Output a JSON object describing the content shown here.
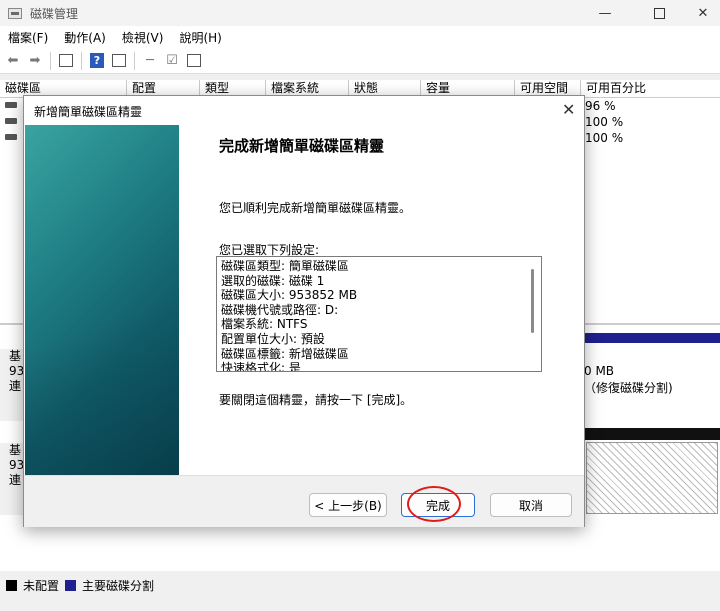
{
  "window": {
    "title": "磁碟管理",
    "minimize": "—",
    "close": "✕"
  },
  "menu": [
    "檔案(F)",
    "動作(A)",
    "檢視(V)",
    "說明(H)"
  ],
  "volume_table": {
    "headers": [
      "磁碟區",
      "配置",
      "類型",
      "檔案系統",
      "狀態",
      "容量",
      "可用空間",
      "可用百分比"
    ],
    "rows": [
      {
        "percent_free": "96 %"
      },
      {
        "percent_free": "100 %"
      },
      {
        "percent_free": "100 %"
      }
    ]
  },
  "disks": [
    {
      "lines": [
        "基",
        "93",
        "連"
      ]
    },
    {
      "lines": [
        "基",
        "93",
        "連"
      ]
    }
  ],
  "partition_info": {
    "size_suffix": "0 MB",
    "status": "（修復磁碟分割)"
  },
  "legend": [
    {
      "label": "未配置",
      "color": "#000000"
    },
    {
      "label": "主要磁碟分割",
      "color": "#1f1f8f"
    }
  ],
  "dialog": {
    "title": "新增簡單磁碟區精靈",
    "close": "✕",
    "heading": "完成新增簡單磁碟區精靈",
    "completed_text": "您已順利完成新增簡單磁碟區精靈。",
    "selected_label": "您已選取下列設定:",
    "settings": [
      "磁碟區類型: 簡單磁碟區",
      "選取的磁碟: 磁碟 1",
      "磁碟區大小: 953852 MB",
      "磁碟機代號或路徑: D:",
      "檔案系統: NTFS",
      "配置單位大小: 預設",
      "磁碟區標籤: 新增磁碟區",
      "快速格式化: 是"
    ],
    "close_instruction": "要關閉這個精靈，請按一下 [完成]。",
    "buttons": {
      "back": "< 上一步(B)",
      "finish": "完成",
      "cancel": "取消"
    }
  }
}
